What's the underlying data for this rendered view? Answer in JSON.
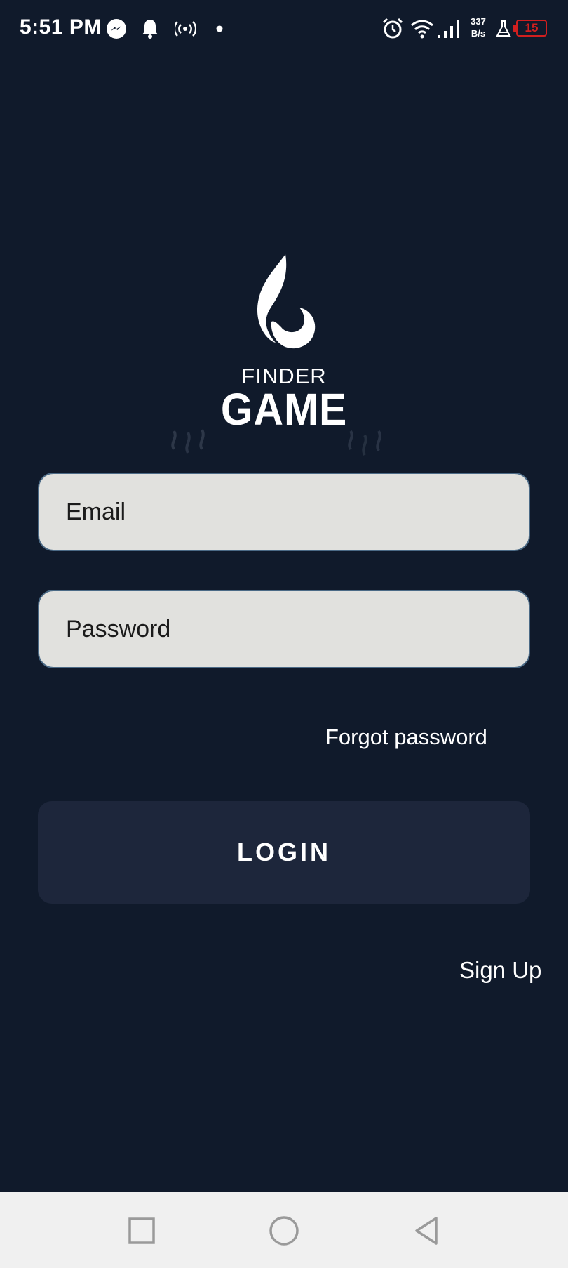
{
  "status_bar": {
    "time": "5:51 PM",
    "net_speed_value": "337",
    "net_speed_unit": "B/s",
    "battery_level": "15",
    "battery_color": "#d11f1f",
    "icons": [
      "messenger-icon",
      "notification-bell-icon",
      "hotspot-icon",
      "dot-icon",
      "alarm-icon",
      "wifi-icon",
      "signal-icon",
      "flask-icon",
      "battery-icon"
    ]
  },
  "logo": {
    "line1": "FINDER",
    "line2": "GAME"
  },
  "form": {
    "email_placeholder": "Email",
    "password_placeholder": "Password",
    "forgot_label": "Forgot password",
    "login_label": "LOGIN",
    "signup_label": "Sign Up"
  },
  "colors": {
    "background": "#101a2b",
    "input_bg": "#e1e1de",
    "input_border": "#4b6a86",
    "button_bg": "#1d263b",
    "nav_bar_bg": "#f0f0f0"
  },
  "nav_bar": {
    "icons": [
      "recent-apps-icon",
      "home-icon",
      "back-icon"
    ]
  }
}
